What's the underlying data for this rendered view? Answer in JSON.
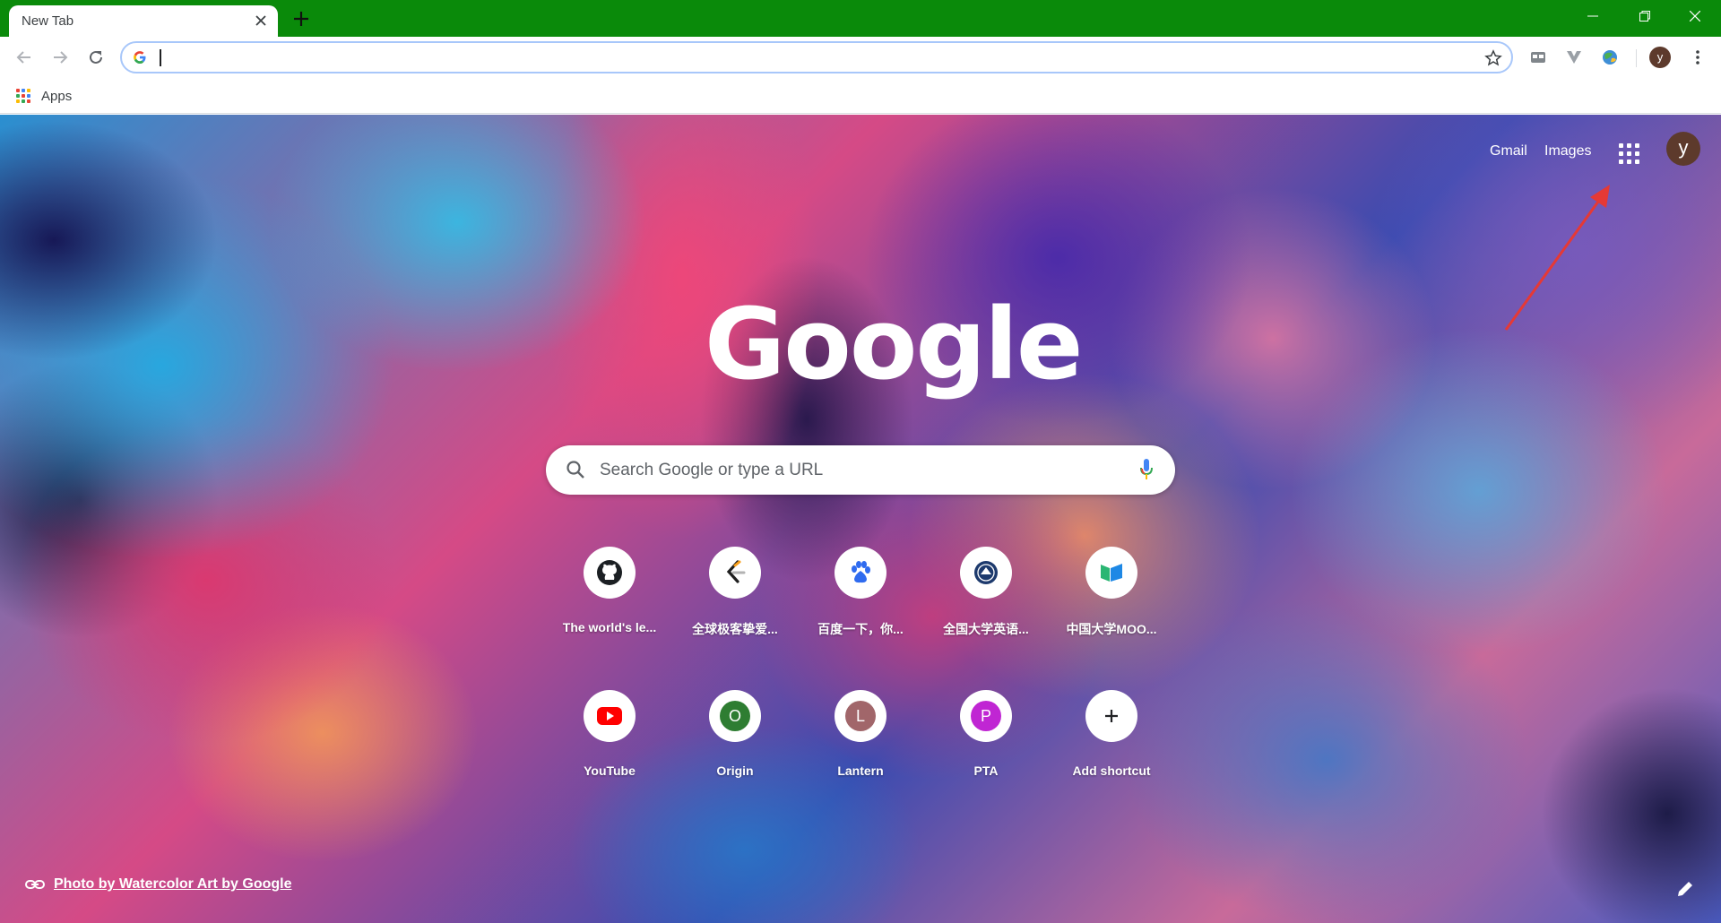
{
  "tab": {
    "title": "New Tab"
  },
  "bookmarks": {
    "apps_label": "Apps"
  },
  "ntp": {
    "gmail": "Gmail",
    "images": "Images",
    "avatar_letter": "y",
    "logo_text": "Google",
    "search_placeholder": "Search Google or type a URL",
    "shortcuts_row1": [
      {
        "label": "The world's le...",
        "icon": "github-icon"
      },
      {
        "label": "全球极客挚爱...",
        "icon": "leetcode-icon"
      },
      {
        "label": "百度一下，你...",
        "icon": "baidu-icon"
      },
      {
        "label": "全国大学英语...",
        "icon": "cet-icon"
      },
      {
        "label": "中国大学MOO...",
        "icon": "mooc-icon"
      }
    ],
    "shortcuts_row2": [
      {
        "label": "YouTube",
        "icon": "youtube-icon"
      },
      {
        "label": "Origin",
        "letter": "O",
        "color": "#2e7d32"
      },
      {
        "label": "Lantern",
        "letter": "L",
        "color": "#a1666a"
      },
      {
        "label": "PTA",
        "letter": "P",
        "color": "#c026d3"
      },
      {
        "label": "Add shortcut",
        "icon": "plus-icon"
      }
    ],
    "attribution": "Photo by Watercolor Art by Google"
  },
  "toolbar": {
    "profile_letter": "y"
  },
  "colors": {
    "titlebar": "#0a8a0a",
    "accent": "#1a73e8",
    "annotation_arrow": "#e53935"
  }
}
